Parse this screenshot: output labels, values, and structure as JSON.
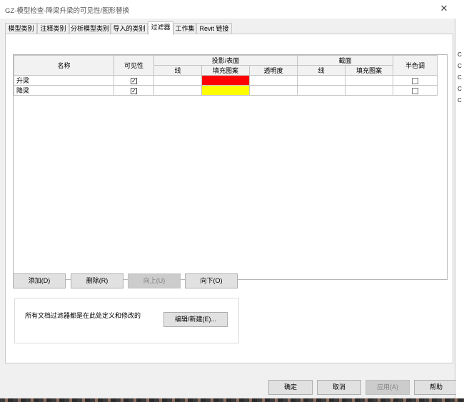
{
  "window": {
    "title": "GZ-模型检查-降梁升梁的可见性/图形替换",
    "close_glyph": "✕"
  },
  "tabs": [
    {
      "label": "模型类别",
      "active": false
    },
    {
      "label": "注释类别",
      "active": false
    },
    {
      "label": "分析模型类别",
      "active": false
    },
    {
      "label": "导入的类别",
      "active": false
    },
    {
      "label": "过滤器",
      "active": true
    },
    {
      "label": "工作集",
      "active": false
    },
    {
      "label": "Revit 链接",
      "active": false
    }
  ],
  "table": {
    "headers": {
      "name": "名称",
      "visibility": "可见性",
      "projection_group": "投影/表面",
      "cut_group": "截面",
      "halftone": "半色调",
      "proj_line": "线",
      "proj_fill": "填充图案",
      "proj_transparency": "透明度",
      "cut_line": "线",
      "cut_fill": "填充图案"
    },
    "rows": [
      {
        "name": "升梁",
        "visible": true,
        "fill_color": "#ff0000",
        "halftone": false
      },
      {
        "name": "降梁",
        "visible": true,
        "fill_color": "#ffff00",
        "halftone": false
      }
    ]
  },
  "buttons": {
    "add": "添加(D)",
    "delete": "删除(R)",
    "up": "向上(U)",
    "down": "向下(O)",
    "edit_new": "编辑/新建(E)...",
    "ok": "确定",
    "cancel": "取消",
    "apply": "应用(A)",
    "help": "帮助"
  },
  "info": {
    "message": "所有文档过滤器都是在此处定义和修改的"
  },
  "check_glyph": "✓",
  "background_marks": [
    "C",
    "C",
    "C",
    "C",
    "C"
  ]
}
